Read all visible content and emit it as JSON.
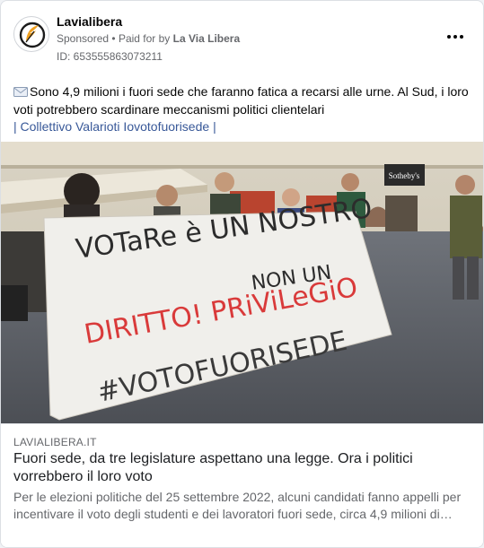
{
  "header": {
    "page_name": "Lavialibera",
    "sponsored": "Sponsored",
    "separator": "•",
    "paid_for_by": "Paid for by",
    "payer": "La Via Libera",
    "ad_id": "ID: 653555863073211"
  },
  "post": {
    "text": "Sono 4,9 milioni i fuori sede che faranno fatica a recarsi alle urne. Al Sud, i loro voti potrebbero scardinare meccanismi politici clientelari",
    "tag_open": "|",
    "tag_text": "Collettivo Valarioti Iovotofuorisede",
    "tag_close": "|"
  },
  "photo": {
    "banner_text": [
      "VOTaRe è UN NOSTRO",
      "NON UN",
      "DIRITTO! PRiViLeGiO",
      "#VOTOFUORISEDE"
    ],
    "shop_sign": "Sotheby's"
  },
  "link_preview": {
    "domain": "LAVIALIBERA.IT",
    "headline": "Fuori sede, da tre legislature aspettano una legge. Ora i politici vorrebbero il loro voto",
    "description": "Per le elezioni politiche del 25 settembre 2022, alcuni candidati fanno appelli per incentivare il voto degli studenti e dei lavoratori fuori sede, circa 4,9 milioni di…"
  },
  "icons": {
    "logo": "feather-quill-logo",
    "more": "more-options-icon",
    "mail": "envelope-icon"
  },
  "colors": {
    "link": "#385898",
    "secondary_text": "#65676b",
    "logo_accent": "#f0a020"
  }
}
